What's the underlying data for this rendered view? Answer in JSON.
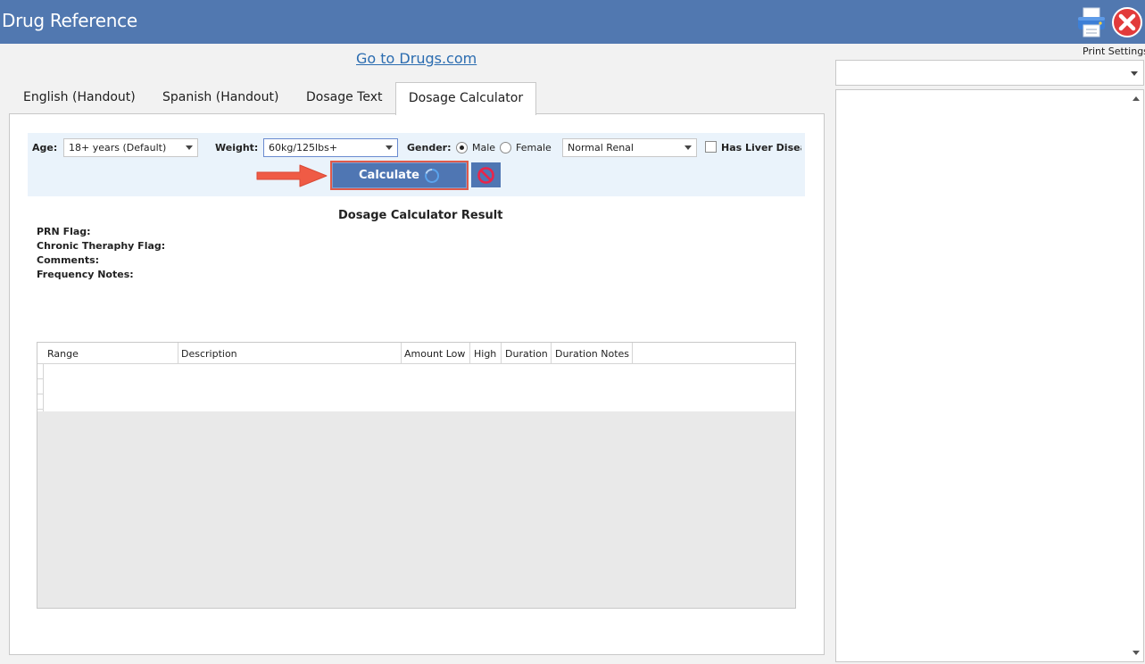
{
  "app": {
    "title": "Drug Reference",
    "print_settings_label": "Print Settings"
  },
  "link": {
    "drugs_com": "Go to Drugs.com"
  },
  "tabs": [
    {
      "label": "English (Handout)",
      "active": false
    },
    {
      "label": "Spanish (Handout)",
      "active": false
    },
    {
      "label": "Dosage Text",
      "active": false
    },
    {
      "label": "Dosage Calculator",
      "active": true
    }
  ],
  "form": {
    "age_label": "Age:",
    "age_value": "18+ years (Default)",
    "weight_label": "Weight:",
    "weight_value": "60kg/125lbs+",
    "gender_label": "Gender:",
    "gender_options": [
      {
        "label": "Male",
        "checked": true
      },
      {
        "label": "Female",
        "checked": false
      }
    ],
    "renal_value": "Normal Renal",
    "liver_label": "Has Liver Diseas",
    "liver_checked": false,
    "calculate_label": "Calculate"
  },
  "result": {
    "title": "Dosage Calculator Result",
    "fields": [
      "PRN Flag:",
      "Chronic Theraphy Flag:",
      "Comments:",
      "Frequency Notes:"
    ]
  },
  "grid": {
    "columns": [
      "Range",
      "Description",
      "Amount Low",
      "High",
      "Duration",
      "Duration Notes"
    ]
  },
  "colors": {
    "titlebar": "#5178b0",
    "accent_button": "#4f76b3",
    "highlight": "#e05a4a",
    "link": "#2b6cb0"
  },
  "icons": {
    "print": "printer-icon",
    "close": "close-icon",
    "cancel": "cancel-icon",
    "spinner": "loading-spinner-icon",
    "annotation": "red-arrow-icon"
  }
}
